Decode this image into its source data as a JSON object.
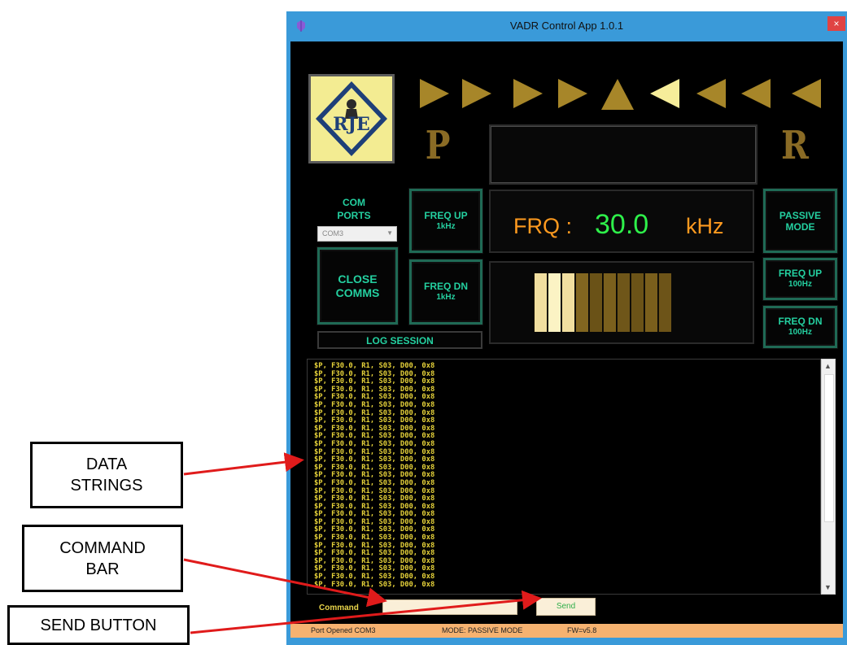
{
  "window": {
    "title": "VADR Control App 1.0.1",
    "close_glyph": "×",
    "icon": "app-icon"
  },
  "logo": {
    "text": "RJE",
    "icon": "rje-logo"
  },
  "arrows": {
    "icons": [
      "play-icon",
      "play-icon",
      "play-icon",
      "play-icon",
      "triangle-up-icon",
      "triangle-left-icon",
      "triangle-left-icon",
      "triangle-left-icon",
      "triangle-left-icon"
    ],
    "highlighted_index": 5
  },
  "letters": {
    "left": "P",
    "right": "R"
  },
  "com_ports": {
    "label_line1": "COM",
    "label_line2": "PORTS",
    "selected": "COM3"
  },
  "buttons": {
    "freq_up_1k": {
      "line1": "FREQ UP",
      "line2": "1kHz"
    },
    "freq_dn_1k": {
      "line1": "FREQ DN",
      "line2": "1kHz"
    },
    "close_comms": {
      "line1": "CLOSE",
      "line2": "COMMS"
    },
    "passive_mode": {
      "line1": "PASSIVE",
      "line2": "MODE"
    },
    "freq_up_100": {
      "line1": "FREQ UP",
      "line2": "100Hz"
    },
    "freq_dn_100": {
      "line1": "FREQ DN",
      "line2": "100Hz"
    },
    "log_session": "LOG SESSION"
  },
  "frequency": {
    "label": "FRQ :",
    "value": "30.0",
    "unit": "kHz"
  },
  "level_meter": {
    "segments": 10,
    "lit_segments": 3
  },
  "log": {
    "lines": [
      "$P, F30.0, R1, S03, D00, 0x8",
      "$P, F30.0, R1, S03, D00, 0x8",
      "$P, F30.0, R1, S03, D00, 0x8",
      "$P, F30.0, R1, S03, D00, 0x8",
      "$P, F30.0, R1, S03, D00, 0x8",
      "$P, F30.0, R1, S03, D00, 0x8",
      "$P, F30.0, R1, S03, D00, 0x8",
      "$P, F30.0, R1, S03, D00, 0x8",
      "$P, F30.0, R1, S03, D00, 0x8",
      "$P, F30.0, R1, S03, D00, 0x8",
      "$P, F30.0, R1, S03, D00, 0x8",
      "$P, F30.0, R1, S03, D00, 0x8",
      "$P, F30.0, R1, S03, D00, 0x8",
      "$P, F30.0, R1, S03, D00, 0x8",
      "$P, F30.0, R1, S03, D00, 0x8",
      "$P, F30.0, R1, S03, D00, 0x8",
      "$P, F30.0, R1, S03, D00, 0x8",
      "$P, F30.0, R1, S03, D00, 0x8",
      "$P, F30.0, R1, S03, D00, 0x8",
      "$P, F30.0, R1, S03, D00, 0x8",
      "$P, F30.0, R1, S03, D00, 0x8",
      "$P, F30.0, R1, S03, D00, 0x8",
      "$P, F30.0, R1, S03, D00, 0x8",
      "$P, F30.0, R1, S03, D00, 0x8",
      "$P, F30.0, R1, S03, D00, 0x8",
      "$P, F30.0, R1, S03, D00, 0x8",
      "$P, F30.0, R1, S03, D00, 0x8",
      "$P, F30.0, R1, S03, D00, 0x8",
      "$P, F30.0, R1, S03, D00, 0x8"
    ]
  },
  "command": {
    "label": "Command",
    "value": "",
    "send_label": "Send"
  },
  "status": {
    "port": "Port Opened COM3",
    "mode": "MODE: PASSIVE MODE",
    "fw": "FW=v5.8"
  },
  "callouts": {
    "data_strings": {
      "line1": "DATA",
      "line2": "STRINGS"
    },
    "command_bar": {
      "line1": "COMMAND",
      "line2": "BAR"
    },
    "send_button": "SEND BUTTON"
  },
  "colors": {
    "accent_green": "#24d0a0",
    "frq_orange": "#ff9a1f",
    "frq_value_green": "#2ef04a",
    "arrow_gold": "#a78629",
    "arrow_highlight": "#f6ed9a",
    "log_yellow": "#e6d23a",
    "status_orange": "#f6b270",
    "callout_arrow_red": "#e01b1b"
  }
}
